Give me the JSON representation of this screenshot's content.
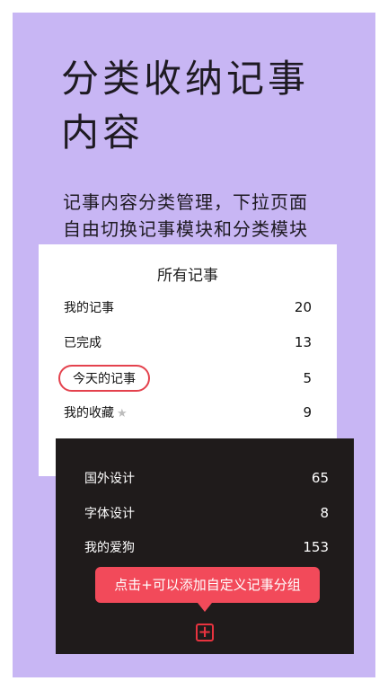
{
  "hero": {
    "title_line1": "分类收纳记事",
    "title_line2": "内容",
    "subtitle_line1": "记事内容分类管理，下拉页面",
    "subtitle_line2": "自由切换记事模块和分类模块"
  },
  "all_notes": {
    "title": "所有记事",
    "items": [
      {
        "label": "我的记事",
        "count": "20"
      },
      {
        "label": "已完成",
        "count": "13"
      },
      {
        "label": "今天的记事",
        "count": "5"
      },
      {
        "label": "我的收藏",
        "count": "9"
      }
    ]
  },
  "categories": {
    "items": [
      {
        "label": "国外设计",
        "count": "65"
      },
      {
        "label": "字体设计",
        "count": "8"
      },
      {
        "label": "我的爱狗",
        "count": "153"
      }
    ],
    "tooltip": "点击+可以添加自定义记事分组",
    "add_icon": "plus-square-icon",
    "add_symbol": "+"
  },
  "colors": {
    "background": "#c8b6f4",
    "accent": "#f24a5a",
    "dark_panel": "#1f1b1b"
  }
}
